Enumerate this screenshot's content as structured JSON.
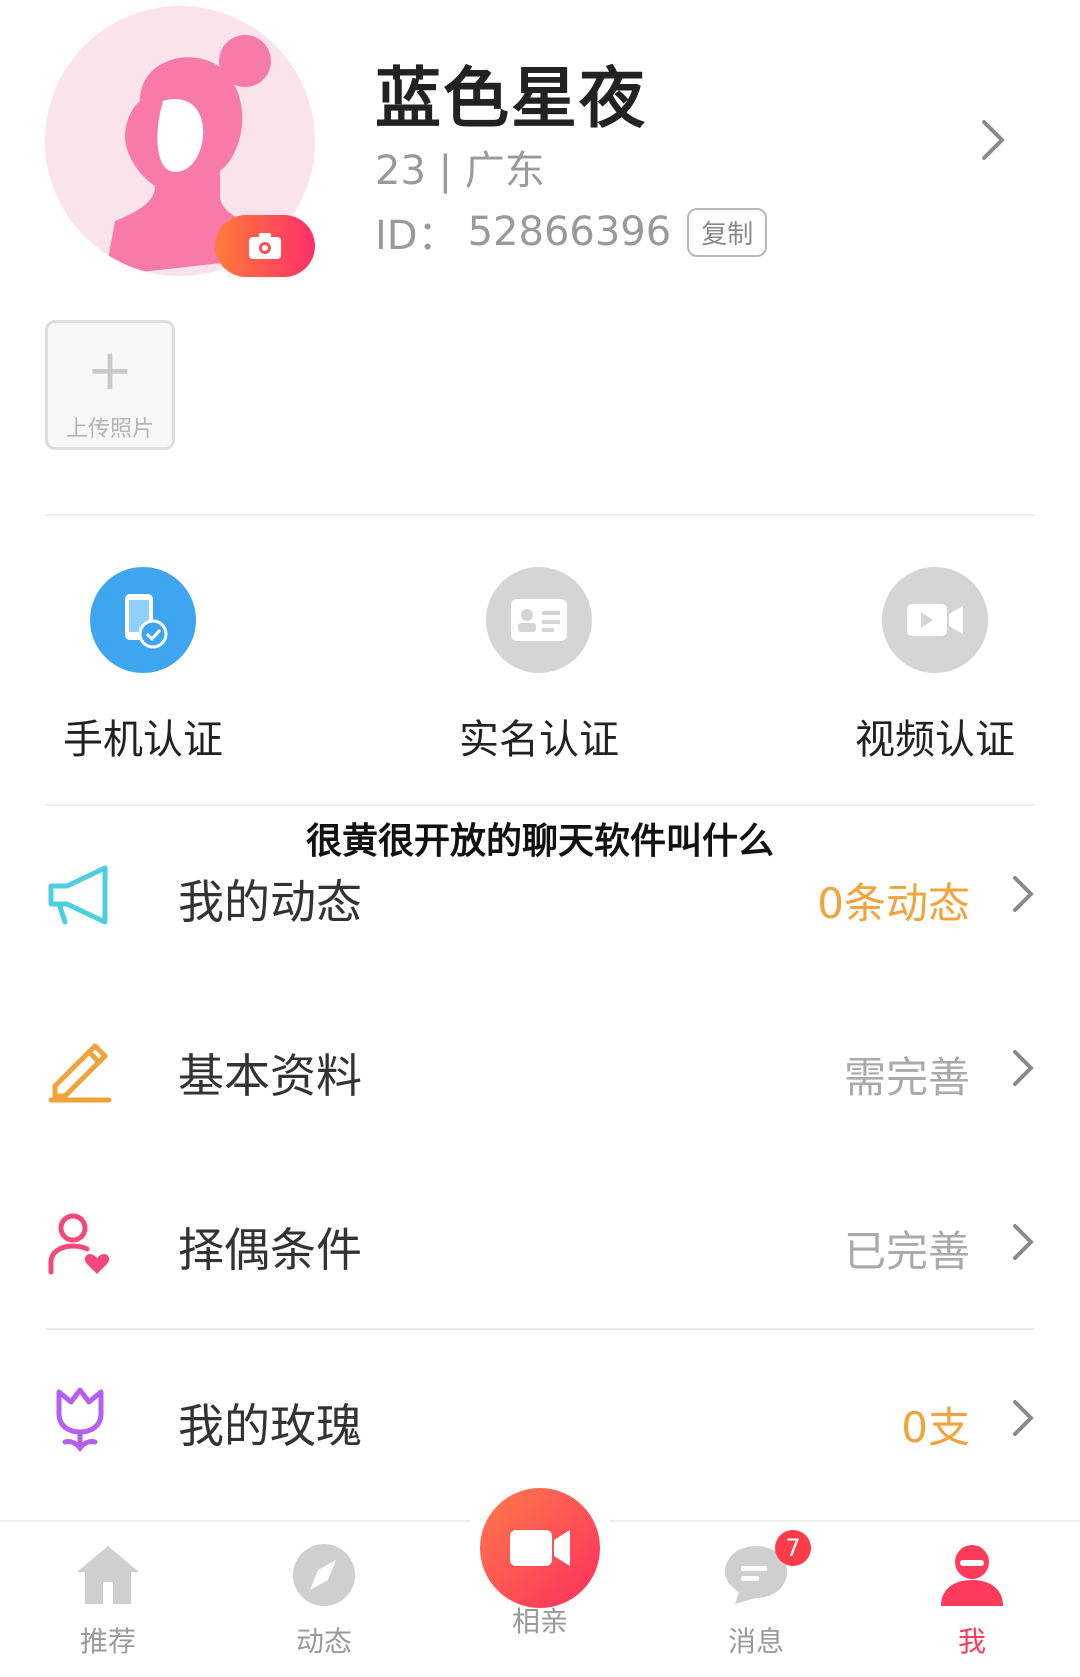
{
  "profile": {
    "name": "蓝色星夜",
    "age_location": "23 | 广东",
    "id_label": "ID：",
    "id_value": "52866396",
    "copy_label": "复制",
    "upload_label": "上传照片",
    "upload_plus": "+"
  },
  "verifications": [
    {
      "label": "手机认证",
      "icon": "phone-verified-icon",
      "status": "verified",
      "color": "#3ea6f0"
    },
    {
      "label": "实名认证",
      "icon": "id-card-icon",
      "status": "unverified",
      "color": "#d5d5d5"
    },
    {
      "label": "视频认证",
      "icon": "video-camera-icon",
      "status": "unverified",
      "color": "#d5d5d5"
    }
  ],
  "overlay_title": "很黄很开放的聊天软件叫什么",
  "menu": [
    {
      "label": "我的动态",
      "value": "0条动态",
      "value_color": "#f3a33a",
      "icon": "megaphone-icon"
    },
    {
      "label": "基本资料",
      "value": "需完善",
      "value_color": "#aaaaaa",
      "icon": "pencil-icon"
    },
    {
      "label": "择偶条件",
      "value": "已完善",
      "value_color": "#aaaaaa",
      "icon": "user-heart-icon"
    },
    {
      "label": "我的玫瑰",
      "value": "0支",
      "value_color": "#f3a33a",
      "icon": "rose-icon"
    }
  ],
  "nav": {
    "items": [
      {
        "label": "推荐",
        "icon": "home-icon"
      },
      {
        "label": "动态",
        "icon": "compass-icon"
      },
      {
        "label": "相亲",
        "icon": "video-camera-icon"
      },
      {
        "label": "消息",
        "icon": "chat-bubble-icon",
        "badge": "7"
      },
      {
        "label": "我",
        "icon": "user-icon",
        "active": true
      }
    ]
  },
  "colors": {
    "accent": "#ff3b5c",
    "gold": "#f3a33a",
    "gray_text": "#9a9a9a"
  }
}
